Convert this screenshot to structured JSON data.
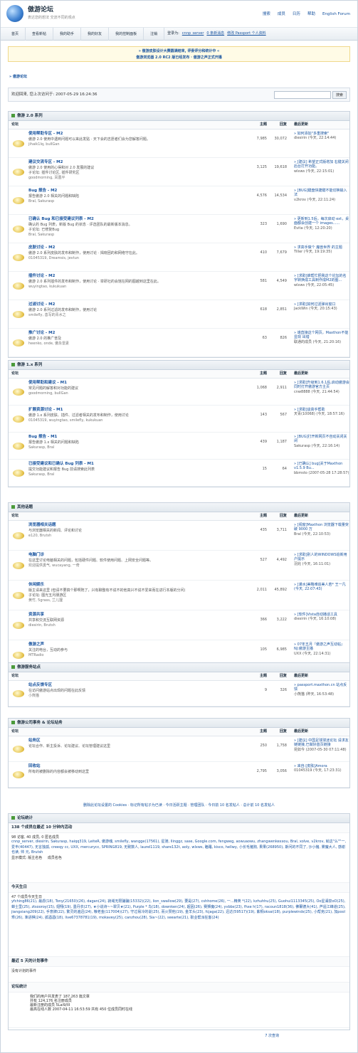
{
  "header": {
    "title": "傲游论坛",
    "slogan": "表达您的想法 交流不同的观点",
    "links": [
      "搜索",
      "成员",
      "日历",
      "帮助",
      "English Forum"
    ]
  },
  "nav": {
    "tabs": [
      "首页",
      "查看新帖",
      "我的助手",
      "我的好友",
      "我的控制面板",
      "注销"
    ],
    "login_prefix": "登录为:",
    "username": "cnnp_server",
    "new_msgs": "0 条新消息",
    "edit_passport": "修改 Passport 个人资料"
  },
  "notice": {
    "line1": "» 傲游皮肤设计大赛圆满结束, 评委评分和统计中 «",
    "line2": "傲游浏览器 2.0 RC2 版已经发布 · 傲游之声正式开播"
  },
  "breadcrumb": "» 傲游论坛",
  "welcome": {
    "text": "欢迎回来, 您上次访问于: 2007-05-29 16:24:36",
    "search_button": "搜索"
  },
  "columns": {
    "forum": "论坛",
    "topics": "主题",
    "posts": "回复",
    "last": "最后更新"
  },
  "sections": [
    {
      "title": "傲游 2.0 系列",
      "rows": [
        {
          "title": "使用帮助专区 - M2",
          "desc": "傲游 2.0 使用中遇到问题可以来此发贴 · 天下会的志愿者们会为您解答问题。",
          "mods": "jihaik1Iq, bullGan",
          "topics": "7,985",
          "posts": "30,072",
          "last_t": "» 如何添加\"多重搜索\"",
          "last_u": "diesirin (今天, 22:14:44)"
        },
        {
          "title": "建议交流专区 - M2",
          "desc": "傲游 2.0 使用的心得和对 2.0 发展的建议",
          "sub": "子论坛: 插件讨论区, 插件研究区",
          "mods": "goodmorning, 凤凰平",
          "topics": "3,125",
          "posts": "19,618",
          "last_t": "» [建议] 希望正式版增加 右键关闭后台打开功能。",
          "last_u": "wlxws (今天, 22:15:01)"
        },
        {
          "title": "Bug 报告 - M2",
          "desc": "报告傲游 2.0 相关的问题和缺陷",
          "mods": "Bral, Sakurasp",
          "topics": "4,576",
          "posts": "14,534",
          "last_t": "» [BUG]键盘快捷键不能切换输入法",
          "last_u": "v2krov (今天, 22:11:24)"
        },
        {
          "title": "已确认 Bug 和已接受建议列表 - M2",
          "desc": "确认的 Bug 列表，新版 Bug 的状态 · 评选团队的最新版本消息。",
          "sub": "子论坛: 已修复Bug",
          "mods": "Bral, Sakurasp",
          "topics": "323",
          "posts": "1,690",
          "last_t": "» 更新到1.5后，每次启动 ext，桌面都会创建一个 images......",
          "last_u": "Evita (今天, 12:20:20)"
        },
        {
          "title": "皮肤讨论 - M2",
          "desc": "傲游 2.0 系列皮肤的发布和制作，使用讨论 · 揭晓团的和网络守在此。",
          "mods": "01045319, Dreamsis, jevtun",
          "topics": "410",
          "posts": "7,679",
          "last_t": "» 求高手做个 魔兽世界 的主题",
          "last_u": "Tiller (今天, 19:19:35)"
        },
        {
          "title": "插件讨论 - M2",
          "desc": "傲游 2.0 系列插件的发布和制作，使用讨论 · 举研社的会馆在网的图越到这里在此。",
          "mods": "wuyingtao, kukukuan",
          "topics": "581",
          "posts": "4,549",
          "last_t": "» [求助]谁帮忙把我这个论坛的名字转换成工具制作成M2的图...",
          "last_u": "wlxws (今天, 22:05:45)"
        },
        {
          "title": "过滤讨论 - M2",
          "desc": "傲游 2.0 系列过滤的发布和制作，使用讨论",
          "mods": "smilefly, 善写的青水之",
          "topics": "618",
          "posts": "2,851",
          "last_t": "» [求助]如何过滤弹出窗口",
          "last_u": "JackWin (今天, 20:15:43)"
        },
        {
          "title": "推广讨论 - M2",
          "desc": "傲游 2.0 的推广普及",
          "mods": "heenko, onde, 傲永雷素",
          "topics": "63",
          "posts": "826",
          "last_t": "» 谁直接这个网页，Maxthon不能显现 出错",
          "last_u": "联通的成员 (今天, 21:20:16)"
        }
      ]
    },
    {
      "title": "傲游 1.x 系列",
      "rows": [
        {
          "title": "使用帮助和建议 - M1",
          "desc": "常见问题的解答和对功能的建议",
          "mods": "goodmorning, bullGan",
          "topics": "1,068",
          "posts": "2,911",
          "last_t": "» [求助]升级到1.6.1后,启动傲游会同时打开傲游官方主页",
          "last_u": "cnw8888 (今天, 21:44:54)"
        },
        {
          "title": "扩展资源讨论 - M1",
          "desc": "傲游 1.x 系列皮肤、插件、过滤者相关的发布和制作，使用讨论",
          "mods": "01045319, wuyingtao, smilefly, kukukuan",
          "topics": "143",
          "posts": "567",
          "last_t": "» [求助]谈高手帮助",
          "last_u": "天青(10068) (今天, 18:57:16)"
        },
        {
          "title": "Bug 报告 - M1",
          "desc": "报告傲游 1.x 相关的问题和缺陷",
          "mods": "Sakurasp, Bral",
          "topics": "439",
          "posts": "1,187",
          "last_t": "» [BUG]打开新网页不自动关闭关闭",
          "last_u": "Sakurasp (今天, 22:16:14)"
        },
        {
          "title": "已接受建议和已确认 Bug 列表 - M1",
          "desc": "提交功能建议和报告 Bug 前请搜索此列表",
          "mods": "Sakurasp, Bral",
          "topics": "15",
          "posts": "64",
          "last_t": "» [已确认] bug]关于Maxthon v1.5.9 Bu...",
          "last_u": "bbmsto (2007-05-28 17:28:57)"
        }
      ]
    },
    {
      "title": "其他话题",
      "rows": [
        {
          "title": "浏览器相关话题",
          "desc": "与浏览器相关的新闻、评论和讨论",
          "mods": "e120, Brutsh",
          "topics": "435",
          "posts": "3,711",
          "last_t": "» [视窗]Maxthon 浏览器下载量突破 9000 万",
          "last_u": "Bral (今天, 22:10:53)"
        },
        {
          "title": "电脑门诊",
          "desc": "在这里讨论电脑相关的问题，包括硬件问题、软件使用问题、上网安全问题等。",
          "mods": "欢迎提供勇气, wucayang, 一奇",
          "topics": "527",
          "posts": "4,492",
          "last_t": "» [求助]别人的WINDOWS追新用户提示",
          "last_u": "羽兆 (今天, 16:11:01)"
        },
        {
          "title": "休闲娱乐",
          "desc": "版主请来这里 (但请不要搞个那啊既了，兴有聊整有不说不的他高兴不说不爱来而在进行本版的分问)",
          "sub": "子论坛: 图光五月朋游区",
          "mods": "黄竹, 5grass, 兰儿狸",
          "topics": "2,011",
          "posts": "45,892",
          "last_t": "» [灌水]美略难追美人若* 王一凡 (今天, 22:07:43)",
          "last_u": ""
        },
        {
          "title": "资源共享",
          "desc": "共享和交流互联网资源",
          "mods": "diesirin, Brutsh",
          "topics": "366",
          "posts": "3,222",
          "last_t": "» [软件]Vista自动播话工具",
          "last_u": "diesirin (今天, 16:10:08)"
        },
        {
          "title": "傲游之声",
          "desc": "关注的电台，互动的参与",
          "mods": "MTRadio",
          "topics": "105",
          "posts": "6,985",
          "last_t": "» 07年五月『傲游之声互动帖』 NJ:傲游主播",
          "last_u": "UXX (今天, 22:14:31)"
        }
      ]
    },
    {
      "title": "傲游服务站点",
      "rows": [
        {
          "title": "站点反馈专区",
          "desc": "在访问傲游站点出现的问题在此反馈",
          "mods": "小熊猫",
          "topics": "9",
          "posts": "326",
          "last_t": "» passport.maxthon.cn 站点反馈",
          "last_u": "小熊猫 (昨天, 16:53:48)"
        }
      ]
    },
    {
      "title": "傲游公司事务 & 论坛站务",
      "rows": [
        {
          "title": "站务区",
          "desc": "论坛合作、新主投诉、论坛建议、论坛管理建议这里",
          "mods": "",
          "topics": "250",
          "posts": "1,758",
          "last_t": "» [建议] 中国足球球迷论坛 请求友链链接,已做好首页链接",
          "last_u": "昆如今 (2007-05-30 07:11:48)"
        },
        {
          "title": "回收站",
          "desc": "所有的被删除的内容都会被移动到这里",
          "mods": "",
          "topics": "2,795",
          "posts": "3,056",
          "last_t": "» 来自:[皮肤]Amora",
          "last_u": "01045319 (今天, 17:23:31)"
        }
      ]
    }
  ],
  "footer_links": "删除此论坛设置的 Cookies · 标记所有帖子为已读 · 今日活跃主题 · 管理团队 · 今日前 10 名发帖人 · 总计前 10 名发帖人",
  "stats": {
    "title": "论坛统计",
    "active_line": "138 个成员在最近 10 分钟内活动",
    "active_detail": "98 访客, 40 成员, 0 匿名成员",
    "active_users": "cnnp_server, diesirin, Sakurasp, haiqq319, LeiteR, 傲游魂, smilefly, wangge(17561), 星驰, llinggz, sase, Google.com, fengweg, aowuaowu, zhangwenkexxou, Bral, xolve, v2krov, 就这\"么\"\"一, 爱丰(40447), 无言独孤, creeqy cc, UXX, mercurycc, SPRING819, 无致数人, laurel1119, share132t, aoly, wlxws, 瞌睡, kisco, hellwy, 小长毛猪狗, 果果(268950), 斯问的不同了, 沙小猪, 雾魔大人, 感谢也读, 帅 元, Brutsh",
    "legend": [
      "显示模式: 版主名色",
      "成员名色"
    ],
    "birthday_title": "今天生日",
    "birthday_count": "47 个成员今天生日",
    "birthday_users": "yfching86(21), 最虐(18), Tony(21650)(26), dagan(24), 寂域无限骗骗(15332)(22), lion_swallow(29), 要是(27), cshhome(26), 一...精英 *(22), kzhuhhu(25), Guohui1113345(25), Oo星澜泉oO(25), 蝉士里(25), ztsooroy(15), 翅翔(19), 墨丹衣(27), ★小说诗~~翠贝★(21), Purple * 鸟(18), downken(24), 超因(26), 赛狮魔(24), yvbbs(23), fhxe h(17), racoun1818(36), 佛爾德大(41), 芦遥江峰道(25), jiangxiang209(22), 手意牌(22), 繁灵的遍迅(24), 粮老金(117004)(27), 守过易冷的说(25), 而火赞他(19), 金羊头(23), fcjaga(22), 迅达(59517)(19), 紫桐oksai(18), purplewinds(25), 小帮克(21), 加pool乖(26), 准进棋(24), 孤酒酒(18), live67378781(19), mokavey(25), canzhou(28), Sia~(22), seearte(21), 职业帮派狂客(24)",
    "events_title": "最近 5 天的计划事件",
    "events_text": "没有计划的事件",
    "stats_title": "论坛统计",
    "stats_line1": "我们的用户共发表了 187,263 篇文章",
    "stats_line2": "共有 124,176 名注册成员",
    "stats_line3": "最新注册的成员 5Lai9/III",
    "stats_line4": "最高在线人数 2007-04-11 16:53:59 共有 450 位成员同时在线"
  },
  "pager": "7 次查询"
}
